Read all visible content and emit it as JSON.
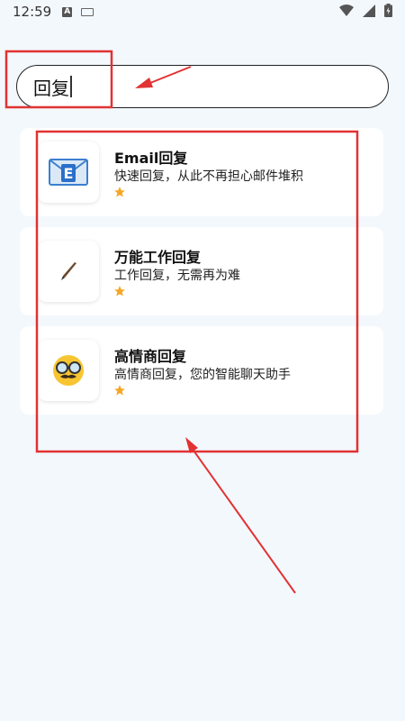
{
  "status_bar": {
    "time": "12:59",
    "notification_icons": [
      "a-icon",
      "keyboard-icon"
    ],
    "system_icons": [
      "wifi-icon",
      "signal-icon",
      "battery-icon"
    ]
  },
  "search": {
    "value": "回复"
  },
  "results": [
    {
      "title": "Email回复",
      "description": "快速回复，从此不再担心邮件堆积",
      "icon": "email-icon",
      "rating_stars": 1
    },
    {
      "title": "万能工作回复",
      "description": "工作回复，无需再为难",
      "icon": "pen-icon",
      "rating_stars": 1
    },
    {
      "title": "高情商回复",
      "description": "高情商回复，您的智能聊天助手",
      "icon": "disguise-face-icon",
      "rating_stars": 1
    }
  ],
  "colors": {
    "background": "#f3f8fd",
    "card": "#ffffff",
    "star": "#f5a623",
    "annotation_red": "#e23232"
  }
}
